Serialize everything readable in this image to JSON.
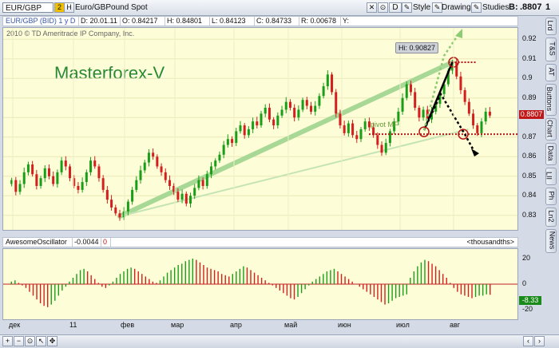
{
  "toolbar": {
    "symbol": "EUR/GBP",
    "description": "Euro/GBPound Spot",
    "chip_count": "2",
    "chip_h": "H",
    "d_button": "D",
    "style_label": "Style",
    "drawings_label": "Drawings",
    "studies_label": "Studies",
    "bid_prefix": "B:",
    "bid_value": ".8807",
    "bid_suffix": "1"
  },
  "infobar": {
    "series": "EUR/GBP (BID) 1 y D",
    "date": "D: 20.01.11",
    "open": "O: 0.84217",
    "high": "H: 0.84801",
    "low": "L: 0.84123",
    "close": "C: 0.84733",
    "range": "R: 0.00678",
    "y": "Y:"
  },
  "main_chart": {
    "copyright": "2010 © TD Ameritrade IP Company, Inc.",
    "watermark": "Masterforex-V",
    "hi_label": "Hi: 0.90827",
    "pivot_label": "pivot MF",
    "price_tag": "0.8807",
    "y_ticks": [
      "0.92",
      "0.91",
      "0.9",
      "0.89",
      "0.88",
      "0.87",
      "0.86",
      "0.85",
      "0.84",
      "0.83"
    ],
    "y_values": [
      0.92,
      0.91,
      0.9,
      0.89,
      0.88,
      0.87,
      0.86,
      0.85,
      0.84,
      0.83
    ]
  },
  "oscillator": {
    "name": "AwesomeOscillator",
    "value": "-0.0044",
    "flag": "0",
    "units": "<thousandths>",
    "y_ticks": [
      "20",
      "0",
      "-20"
    ],
    "current_tag": "-8.33"
  },
  "x_axis": {
    "labels": [
      "дек",
      "11",
      "фев",
      "мар",
      "апр",
      "май",
      "июн",
      "июл",
      "авг"
    ]
  },
  "side_tabs": [
    "Lrd",
    "T&S",
    "AT",
    "Buttons",
    "Chart",
    "Data",
    "LII",
    "Ph",
    "Ln2",
    "News"
  ],
  "colors": {
    "pane_bg": "#fdfdd7",
    "up_candle": "#1a9e1a",
    "down_candle": "#d41f1f",
    "trend_channel": "#9ed38a",
    "watermark": "#2a8a2a",
    "price_tag": "#c01818",
    "osc_tag": "#1a8a1a"
  },
  "chart_data": {
    "type": "candlestick",
    "title": "EUR/GBP (BID) 1 y D",
    "ylim": [
      0.825,
      0.925
    ],
    "x_labels": [
      "дек",
      "11",
      "фев",
      "мар",
      "апр",
      "май",
      "июн",
      "июл",
      "авг"
    ],
    "closes": [
      0.848,
      0.842,
      0.846,
      0.852,
      0.856,
      0.851,
      0.845,
      0.849,
      0.854,
      0.85,
      0.846,
      0.852,
      0.858,
      0.855,
      0.849,
      0.845,
      0.843,
      0.847,
      0.852,
      0.858,
      0.855,
      0.849,
      0.843,
      0.838,
      0.834,
      0.831,
      0.829,
      0.832,
      0.837,
      0.843,
      0.848,
      0.853,
      0.857,
      0.862,
      0.86,
      0.855,
      0.852,
      0.848,
      0.845,
      0.842,
      0.838,
      0.841,
      0.836,
      0.84,
      0.844,
      0.848,
      0.845,
      0.851,
      0.855,
      0.858,
      0.861,
      0.866,
      0.869,
      0.867,
      0.873,
      0.876,
      0.871,
      0.874,
      0.878,
      0.876,
      0.882,
      0.885,
      0.879,
      0.876,
      0.881,
      0.884,
      0.888,
      0.885,
      0.88,
      0.884,
      0.889,
      0.886,
      0.883,
      0.886,
      0.891,
      0.896,
      0.902,
      0.893,
      0.882,
      0.876,
      0.872,
      0.877,
      0.871,
      0.869,
      0.874,
      0.878,
      0.875,
      0.871,
      0.866,
      0.862,
      0.867,
      0.873,
      0.878,
      0.883,
      0.89,
      0.897,
      0.893,
      0.885,
      0.88,
      0.884,
      0.879,
      0.883,
      0.887,
      0.892,
      0.897,
      0.904,
      0.908,
      0.901,
      0.894,
      0.888,
      0.882,
      0.876,
      0.872,
      0.878,
      0.883,
      0.881
    ],
    "hi_point": 0.90827,
    "pivot_level": 0.8715,
    "oscillator_values": [
      2,
      3,
      1,
      -1,
      -3,
      -6,
      -9,
      -12,
      -15,
      -17,
      -18,
      -16,
      -13,
      -9,
      -5,
      -2,
      2,
      5,
      8,
      11,
      12,
      10,
      7,
      4,
      1,
      -2,
      -3,
      -1,
      2,
      5,
      8,
      10,
      12,
      13,
      12,
      10,
      8,
      6,
      4,
      2,
      1,
      3,
      6,
      9,
      11,
      13,
      15,
      16,
      18,
      19,
      20,
      19,
      17,
      15,
      13,
      12,
      11,
      10,
      8,
      7,
      6,
      8,
      10,
      12,
      14,
      13,
      11,
      9,
      7,
      5,
      3,
      1,
      -1,
      -3,
      -5,
      -7,
      -9,
      -11,
      -12,
      -10,
      -7,
      -4,
      -1,
      2,
      4,
      6,
      8,
      10,
      11,
      12,
      10,
      8,
      6,
      4,
      2,
      0,
      -2,
      -4,
      -6,
      -8,
      -10,
      -12,
      -14,
      -16,
      -15,
      -13,
      -11,
      -10,
      -9,
      -8,
      5,
      10,
      14,
      17,
      19,
      18,
      16,
      14,
      11,
      8,
      5,
      1,
      -3,
      -6,
      -8,
      -9,
      -10,
      -11,
      -10,
      -9,
      -9,
      -8,
      -8.33
    ]
  }
}
